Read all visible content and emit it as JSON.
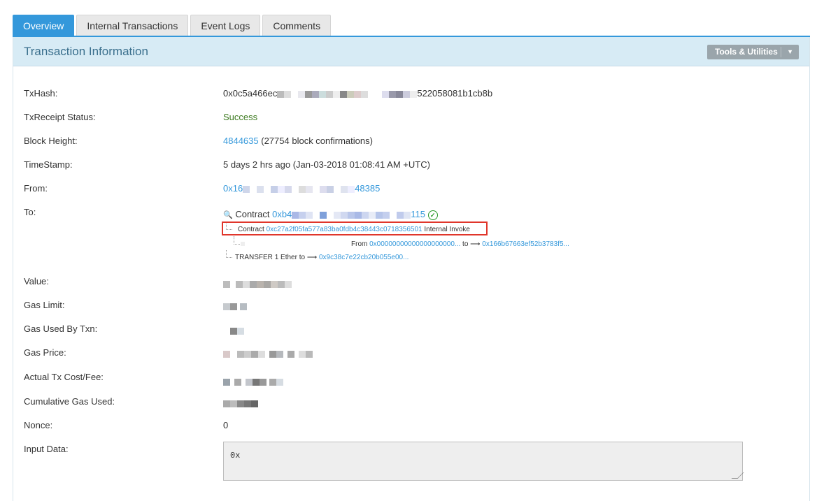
{
  "tabs": [
    {
      "label": "Overview"
    },
    {
      "label": "Internal Transactions"
    },
    {
      "label": "Event Logs"
    },
    {
      "label": "Comments"
    }
  ],
  "panel": {
    "title": "Transaction Information",
    "tools_label": "Tools & Utilities"
  },
  "fields": {
    "txhash": {
      "label": "TxHash:",
      "prefix": "0x0c5a466ec",
      "suffix": "522058081b1cb8b"
    },
    "status": {
      "label": "TxReceipt Status:",
      "value": "Success"
    },
    "block": {
      "label": "Block Height:",
      "number": "4844635",
      "confirmations": "(27754 block confirmations)"
    },
    "timestamp": {
      "label": "TimeStamp:",
      "value": "5 days 2 hrs ago (Jan-03-2018 01:08:41 AM +UTC)"
    },
    "from": {
      "label": "From:",
      "prefix": "0x16",
      "suffix": "48385"
    },
    "to": {
      "label": "To:",
      "contract_word": "Contract",
      "prefix": "0xb4",
      "suffix": "115"
    },
    "value": {
      "label": "Value:"
    },
    "gas_limit": {
      "label": "Gas Limit:"
    },
    "gas_used": {
      "label": "Gas Used By Txn:"
    },
    "gas_price": {
      "label": "Gas Price:"
    },
    "tx_cost": {
      "label": "Actual Tx Cost/Fee:"
    },
    "cumulative_gas": {
      "label": "Cumulative Gas Used:"
    },
    "nonce": {
      "label": "Nonce:",
      "value": "0"
    },
    "input": {
      "label": "Input Data:",
      "value": "0x"
    }
  },
  "trace": {
    "invoke": {
      "contract_word": "Contract",
      "address": "0xc27a2f05fa577a83ba0fdb4c38443c0718356501",
      "note": "Internal Invoke"
    },
    "transfer_row": {
      "from_word": "From",
      "from_addr": "0x00000000000000000000...",
      "to_word": "to",
      "to_addr": "0x166b67663ef52b3783f5..."
    },
    "ether_row": {
      "type": "TRANSFER",
      "amount": "1 Ether",
      "to_word": "to",
      "to_addr": "0x9c38c7e22cb20b055e00..."
    }
  },
  "colors": {
    "accent": "#3498db",
    "success": "#3c7a1f",
    "highlight": "#e0362b",
    "header_bg": "#d7ebf5"
  }
}
